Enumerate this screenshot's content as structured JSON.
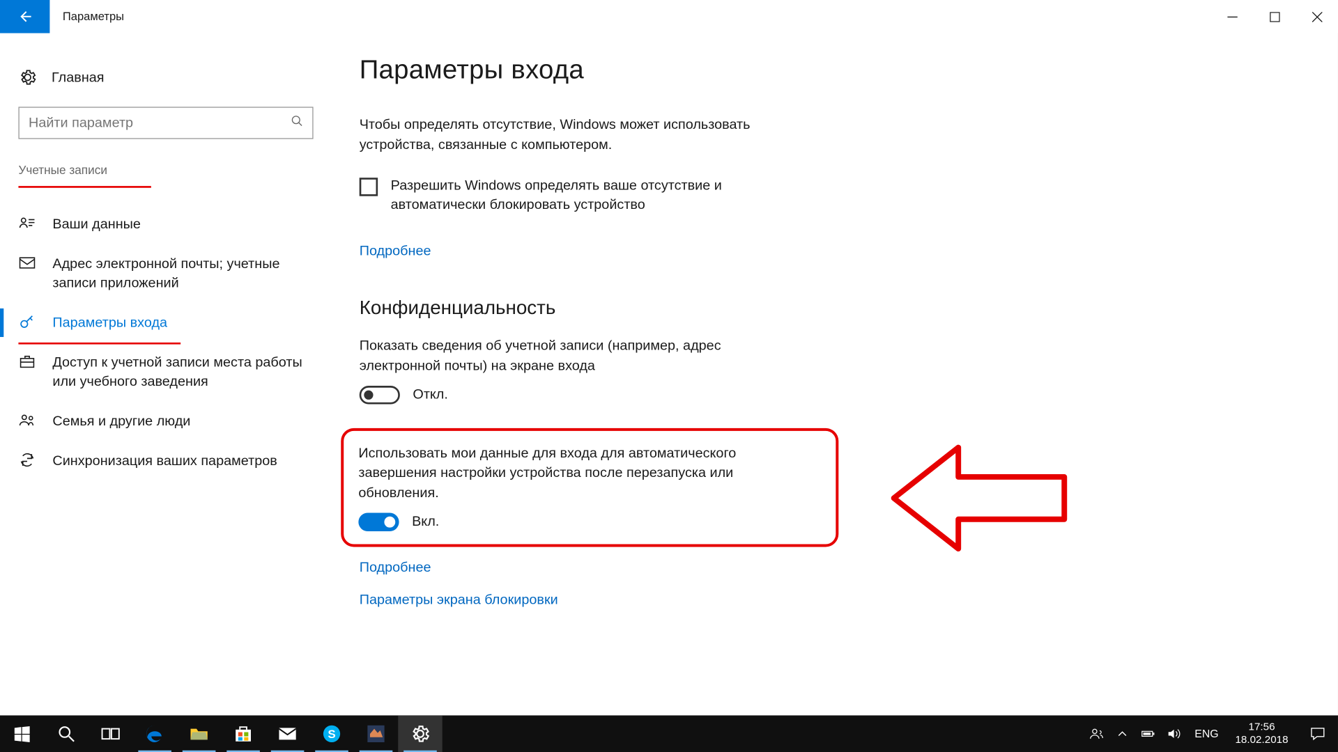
{
  "titlebar": {
    "title": "Параметры"
  },
  "sidebar": {
    "home": "Главная",
    "search_placeholder": "Найти параметр",
    "category": "Учетные записи",
    "items": [
      {
        "label": "Ваши данные"
      },
      {
        "label": "Адрес электронной почты; учетные записи приложений"
      },
      {
        "label": "Параметры входа"
      },
      {
        "label": "Доступ к учетной записи места работы или учебного заведения"
      },
      {
        "label": "Семья и другие люди"
      },
      {
        "label": "Синхронизация ваших параметров"
      }
    ]
  },
  "main": {
    "heading": "Параметры входа",
    "presence_desc": "Чтобы определять отсутствие, Windows может использовать устройства, связанные с компьютером.",
    "presence_checkbox": "Разрешить Windows определять ваше отсутствие и автоматически блокировать устройство",
    "more_link_1": "Подробнее",
    "privacy_heading": "Конфиденциальность",
    "setting1_text": "Показать сведения об учетной записи (например, адрес электронной почты) на экране входа",
    "setting1_state": "Откл.",
    "setting2_text": "Использовать мои данные для входа для автоматического завершения настройки устройства после перезапуска или обновления.",
    "setting2_state": "Вкл.",
    "more_link_2": "Подробнее",
    "lockscreen_link": "Параметры экрана блокировки"
  },
  "taskbar": {
    "language": "ENG",
    "time": "17:56",
    "date": "18.02.2018"
  }
}
